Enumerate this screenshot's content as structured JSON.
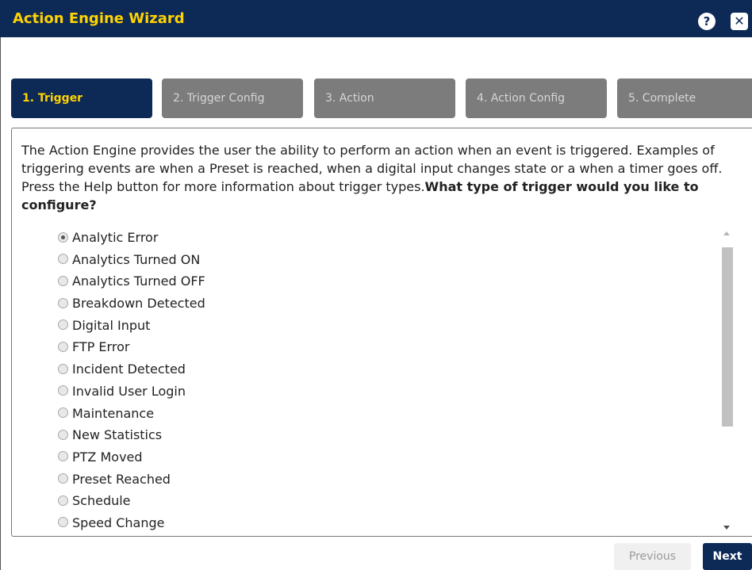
{
  "window": {
    "title": "Action Engine Wizard",
    "help_glyph": "?",
    "close_glyph": "✕"
  },
  "steps": [
    {
      "label": "1. Trigger",
      "active": true
    },
    {
      "label": "2. Trigger Config",
      "active": false
    },
    {
      "label": "3. Action",
      "active": false
    },
    {
      "label": "4. Action Config",
      "active": false
    },
    {
      "label": "5. Complete",
      "active": false
    }
  ],
  "intro": {
    "text": "The Action Engine provides the user the ability to perform an action when an event is triggered. Examples of triggering events are when a Preset is reached, when a digital input changes state or a when a timer goes off. Press the Help button for more information about trigger types.",
    "question": "What type of trigger would you like to configure?"
  },
  "trigger_options": [
    {
      "label": "Analytic Error",
      "selected": true
    },
    {
      "label": "Analytics Turned ON",
      "selected": false
    },
    {
      "label": "Analytics Turned OFF",
      "selected": false
    },
    {
      "label": "Breakdown Detected",
      "selected": false
    },
    {
      "label": "Digital Input",
      "selected": false
    },
    {
      "label": "FTP Error",
      "selected": false
    },
    {
      "label": "Incident Detected",
      "selected": false
    },
    {
      "label": "Invalid User Login",
      "selected": false
    },
    {
      "label": "Maintenance",
      "selected": false
    },
    {
      "label": "New Statistics",
      "selected": false
    },
    {
      "label": "PTZ Moved",
      "selected": false
    },
    {
      "label": "Preset Reached",
      "selected": false
    },
    {
      "label": "Schedule",
      "selected": false
    },
    {
      "label": "Speed Change",
      "selected": false
    }
  ],
  "buttons": {
    "previous": "Previous",
    "next": "Next"
  },
  "colors": {
    "header_bg": "#0d2a57",
    "title_color": "#ffd200",
    "step_inactive": "#7c7c7c"
  }
}
